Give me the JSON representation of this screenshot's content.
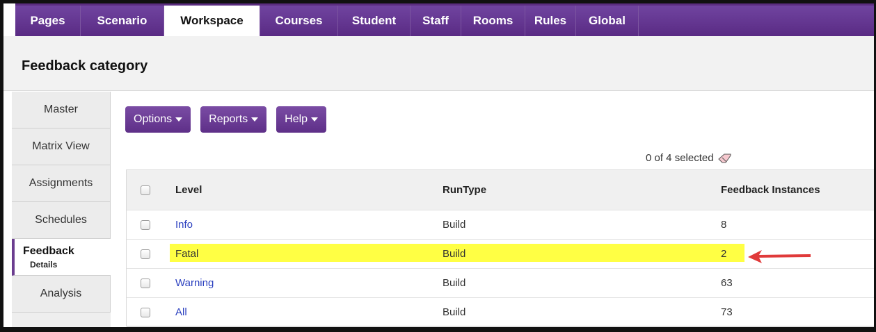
{
  "topnav": {
    "tabs": [
      {
        "label": "Pages",
        "active": false,
        "width": 94
      },
      {
        "label": "Scenario",
        "active": false,
        "width": 120
      },
      {
        "label": "Workspace",
        "active": true,
        "width": 138
      },
      {
        "label": "Courses",
        "active": false,
        "width": 112
      },
      {
        "label": "Student",
        "active": false,
        "width": 104
      },
      {
        "label": "Staff",
        "active": false,
        "width": 73
      },
      {
        "label": "Rooms",
        "active": false,
        "width": 92
      },
      {
        "label": "Rules",
        "active": false,
        "width": 73
      },
      {
        "label": "Global",
        "active": false,
        "width": 90
      }
    ]
  },
  "header": {
    "title": "Feedback category"
  },
  "sidenav": {
    "items": [
      {
        "label": "Master"
      },
      {
        "label": "Matrix View"
      },
      {
        "label": "Assignments"
      },
      {
        "label": "Schedules"
      },
      {
        "label": "Feedback",
        "sub": "Details",
        "active": true
      },
      {
        "label": "Analysis"
      }
    ]
  },
  "toolbar": {
    "options": "Options",
    "reports": "Reports",
    "help": "Help"
  },
  "selection": {
    "text": "0 of 4 selected"
  },
  "table": {
    "columns": [
      "Level",
      "RunType",
      "Feedback Instances"
    ],
    "rows": [
      {
        "level": "Info",
        "runtype": "Build",
        "instances": "8"
      },
      {
        "level": "Fatal",
        "runtype": "Build",
        "instances": "2",
        "highlighted": true
      },
      {
        "level": "Warning",
        "runtype": "Build",
        "instances": "63"
      },
      {
        "level": "All",
        "runtype": "Build",
        "instances": "73"
      }
    ]
  },
  "colors": {
    "nav_purple": "#5b2d80",
    "highlight": "#ffff44",
    "link": "#2a3fbf",
    "arrow": "#e03a3a"
  }
}
